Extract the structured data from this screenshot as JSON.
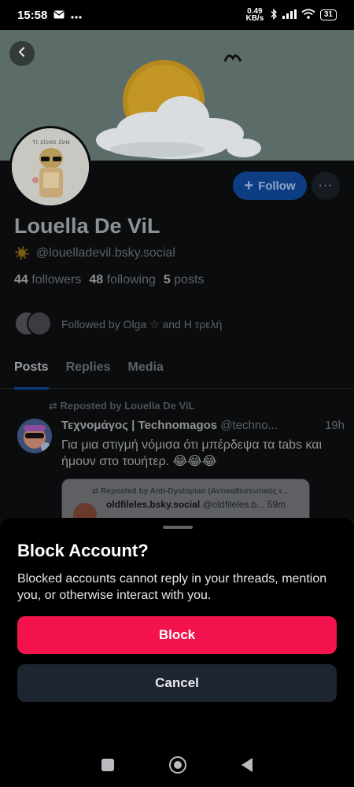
{
  "status_bar": {
    "time": "15:58",
    "left_icons": [
      "mail-icon",
      "more-dots-icon"
    ],
    "net_speed": "0.49 KB/s",
    "right_icons": [
      "bluetooth-icon",
      "signal-icon",
      "wifi-icon"
    ],
    "battery": "31"
  },
  "header": {
    "back_icon": "chevron-left-icon"
  },
  "banner": {
    "colors": {
      "sky": "#5b6c69",
      "sun": "#b5891e",
      "cloud": "#d9dde0"
    }
  },
  "profile": {
    "display_name": "Louella De ViL",
    "handle_emoji": "☀️",
    "handle": "@louelladevil.bsky.social",
    "avatar_caption": "τι είναι ένα",
    "follow_label": "Follow",
    "more_label": "···",
    "stats": {
      "followers_count": "44",
      "followers_label": "followers",
      "following_count": "48",
      "following_label": "following",
      "posts_count": "5",
      "posts_label": "posts"
    },
    "followed_by": "Followed by Olga ☆ and Η τρελή"
  },
  "tabs": [
    {
      "label": "Posts",
      "active": true
    },
    {
      "label": "Replies",
      "active": false
    },
    {
      "label": "Media",
      "active": false
    }
  ],
  "post": {
    "repost_line": "Reposted by Louella De ViL",
    "author": "Τεχνομάγος | Technomagos",
    "handle": "@techno...",
    "time": "19h",
    "text": "Για μια στιγμή νόμισα ότι μπέρδεψα τα tabs και ήμουν στο τουήτερ. 😂😂😂",
    "quote": {
      "repost_line": "Reposted by Anti-Dystopian (Αντικαθεστωτικός ι...",
      "author": "oldfileles.bsky.social",
      "handle": "@oldfileles.b...",
      "time": "59m"
    }
  },
  "sheet": {
    "title": "Block Account?",
    "description": "Blocked accounts cannot reply in your threads, mention you, or otherwise interact with you.",
    "block_label": "Block",
    "cancel_label": "Cancel",
    "colors": {
      "block": "#f2134c",
      "cancel": "#1c2530"
    }
  },
  "nav_bar": {
    "icons": [
      "recents-square-icon",
      "home-circle-icon",
      "back-triangle-icon"
    ]
  }
}
